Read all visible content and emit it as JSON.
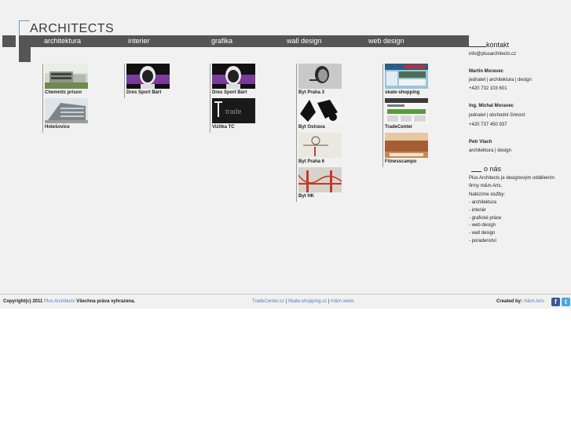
{
  "logo": {
    "text": "ARCHITECTS"
  },
  "nav": {
    "items": [
      "architektura",
      "interier",
      "grafika",
      "wall design",
      "web design"
    ]
  },
  "columns": {
    "architektura": [
      {
        "caption": "Chemnitz prison",
        "icon": "building-photo"
      },
      {
        "caption": "Holešovice",
        "icon": "building-photo"
      }
    ],
    "interier": [
      {
        "caption": "Dres Sport Bárt",
        "icon": "portrait-purple"
      }
    ],
    "grafika": [
      {
        "caption": "Dres Sport Bárt",
        "icon": "portrait-purple"
      },
      {
        "caption": "Vizitka TC",
        "icon": "tradecenter-card"
      }
    ],
    "wall_design": [
      {
        "caption": "Byt Praha 3",
        "icon": "face-wall-art"
      },
      {
        "caption": "Byt Ostrava",
        "icon": "bw-wall-art"
      },
      {
        "caption": "Byt Praha 6",
        "icon": "sketch-wall-art"
      },
      {
        "caption": "Byt HK",
        "icon": "bridge-wall-art"
      }
    ],
    "web_design": [
      {
        "caption": "skate-shopping",
        "icon": "website-screenshot"
      },
      {
        "caption": "TradeCenter",
        "icon": "website-screenshot"
      },
      {
        "caption": "Fitnesscampo",
        "icon": "website-screenshot"
      }
    ]
  },
  "sidebar": {
    "kontakt_heading": "kontakt",
    "email": "info@plusarchitects.cz",
    "people": [
      {
        "name": "Martin Moravec",
        "role": "jednatel | architektura | design",
        "phone": "+420 732 103 601"
      },
      {
        "name": "Ing. Michal Moravec",
        "role": "jednatel | obchodní činnost",
        "phone": "+420 737 450 937"
      },
      {
        "name": "Petr Vlach",
        "role": "architektura | design",
        "phone": ""
      }
    ],
    "onas_heading": "o nás",
    "about_1": "Plus Architects je designovým oddělením",
    "about_2": "firmy m&m Arts.",
    "services_intro": "Nabízíme služby:",
    "services": [
      "- architektura",
      "- interiér",
      "- grafické práce",
      "- web design",
      "- wall design",
      "- poradenství"
    ]
  },
  "footer": {
    "copyright_prefix": "Copyright(c) 2011",
    "brand": "Plus Architects",
    "copyright_suffix": "Všechna práva vyhrazena.",
    "link1": "TradeCenter.cz",
    "sep": "|",
    "link2": "Skate-shopping.cz",
    "link3": "m&m webs",
    "created_label": "Created by:",
    "created_link": "m&m Arts"
  },
  "colors": {
    "accent": "#4a7fc0",
    "nav_bg": "#555555",
    "bg": "#f1f1f1"
  }
}
